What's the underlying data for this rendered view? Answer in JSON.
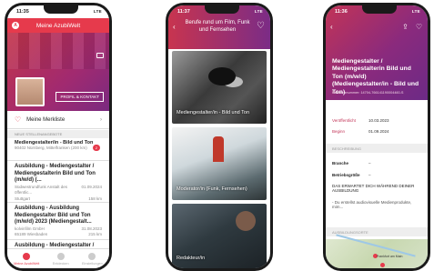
{
  "phone1": {
    "time": "11:35",
    "signal": "LTE",
    "title": "Meine AzubiWelt",
    "logo": "A",
    "profile_button": "PROFIL & KONTAKT",
    "merkliste": "Meine Merkliste",
    "section_new": "NEUE STELLENANGEBOTE",
    "filter_title": "Mediengestalter/in - Bild und Ton",
    "filter_sub": "90402 Nürnberg, Mittelfranken (200 km)",
    "filter_badge": "2",
    "jobs": [
      {
        "title": "Ausbildung - Mediengestalter / Mediengestalterin Bild und Ton (m/w/d) (...",
        "company": "Südwestrundfunk Anstalt des öffentlic...",
        "date": "01.09.2024",
        "city": "Stuttgart",
        "dist": "158 km"
      },
      {
        "title": "Ausbildung - Ausbildung Mediengestalter Bild und Ton (m/w/d) 2023 (Mediengestalt...",
        "company": "kolvinfilm GmbH",
        "date": "31.08.2023",
        "city": "65189 Wiesbaden",
        "dist": "215 km"
      },
      {
        "title": "Ausbildung - Mediengestalter / Mediengestalterin Bild und Ton (m/w/d) (..."
      }
    ],
    "nav": [
      "Meine AzubiWelt",
      "Entdecken",
      "Einstellungen"
    ]
  },
  "phone2": {
    "time": "11:37",
    "title": "Berufe rund um Film, Funk und Fernsehen",
    "tiles": [
      "Mediengestalter/in - Bild und Ton",
      "Moderator/in (Funk, Fernsehen)",
      "Redakteur/in"
    ]
  },
  "phone3": {
    "time": "11:36",
    "job_title": "Mediengestalter / Mediengestalterin Bild und Ton (m/w/d) (Mediengestalter/in - Bild und Ton)",
    "ref": "Referenznummer: 14704-766141190004460-S",
    "published_label": "Veröffentlicht",
    "published": "10.03.2023",
    "start_label": "Beginn",
    "start": "01.09.2024",
    "section_desc": "BESCHREIBUNG",
    "branche_label": "Branche",
    "branche": "–",
    "betrieb_label": "Betriebsgröße",
    "betrieb": "–",
    "expect": "DAS ERWARTET DICH WÄHREND DEINER AUSBILDUNG",
    "expect_text": "- Du erstellst audiovisuelle Medienprodukte, mim...",
    "section_place": "AUSBILDUNGSORTE",
    "map_label": "Frankfurt am Main"
  },
  "colors": {
    "accent": "#e63a4c",
    "gradient_start": "#c8344f",
    "gradient_end": "#7b2c86"
  }
}
